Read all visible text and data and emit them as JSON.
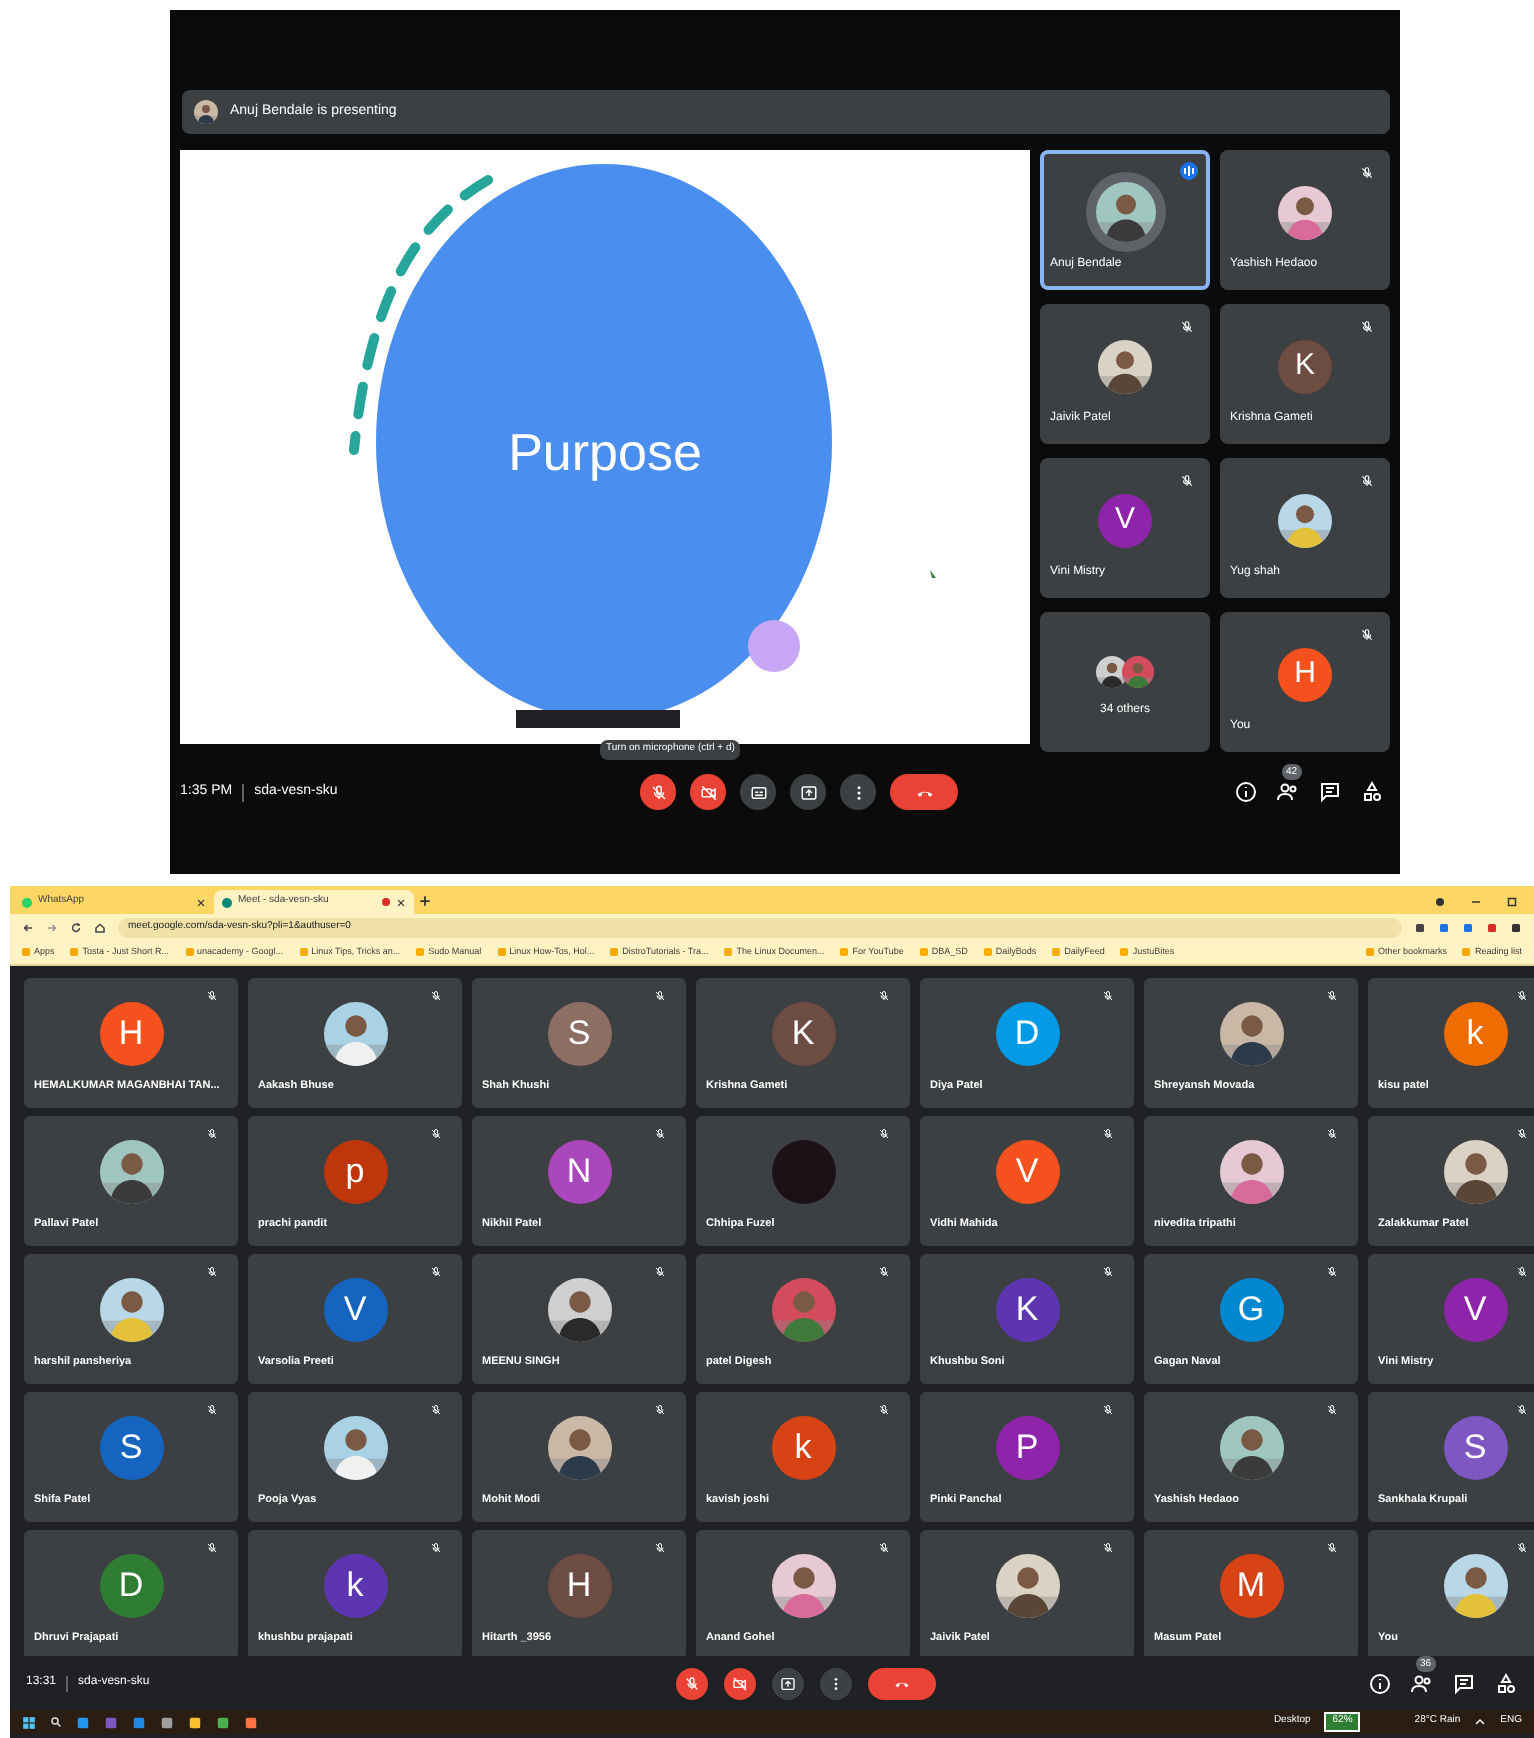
{
  "top_meeting": {
    "presenter_banner": "Anuj Bendale is presenting",
    "slide": {
      "title": "Purpose"
    },
    "tiles": [
      {
        "kind": "person",
        "name": "Anuj Bendale",
        "muted": false,
        "speaking": true,
        "selected": true
      },
      {
        "kind": "person",
        "name": "Yashish Hedaoo",
        "muted": true,
        "speaking": false,
        "selected": false
      },
      {
        "kind": "person",
        "name": "Jaivik Patel",
        "muted": true,
        "speaking": false,
        "selected": false
      },
      {
        "kind": "person",
        "name": "Krishna Gameti",
        "avatar": {
          "kind": "letter",
          "letter": "K",
          "color": "#6d4c41"
        },
        "muted": true,
        "speaking": false,
        "selected": false
      },
      {
        "kind": "person",
        "name": "Vini Mistry",
        "avatar": {
          "kind": "letter",
          "letter": "V",
          "color": "#8e24aa"
        },
        "muted": true,
        "speaking": false,
        "selected": false
      },
      {
        "kind": "person",
        "name": "Yug shah",
        "muted": true,
        "speaking": false,
        "selected": false
      },
      {
        "kind": "others",
        "name": "34 others",
        "muted": false,
        "speaking": false,
        "selected": false
      },
      {
        "kind": "person",
        "name": "You",
        "avatar": {
          "kind": "letter",
          "letter": "H",
          "color": "#f4511e"
        },
        "muted": true,
        "speaking": false,
        "selected": false
      }
    ],
    "time": "1:35 PM",
    "meeting_code": "sda-vesn-sku",
    "tooltip": "Turn on microphone (ctrl + d)",
    "controls": [
      {
        "kind": "mic",
        "on": false
      },
      {
        "kind": "camera",
        "on": false
      },
      {
        "kind": "captions"
      },
      {
        "kind": "present"
      },
      {
        "kind": "more"
      },
      {
        "kind": "leave"
      }
    ],
    "participant_count": "42"
  },
  "browser": {
    "tabs": [
      {
        "title": "WhatsApp",
        "selected": false,
        "recording": false
      },
      {
        "title": "Meet - sda-vesn-sku",
        "selected": true,
        "recording": true
      }
    ],
    "url": "meet.google.com/sda-vesn-sku?pli=1&authuser=0",
    "bookmarks": [
      "Apps",
      "Tosta - Just Short R...",
      "unacademy - Googl...",
      "Linux Tips, Tricks an...",
      "Sudo Manual",
      "Linux How-Tos, Hol...",
      "DistroTutorials - Tra...",
      "The Linux Documen...",
      "For YouTube",
      "DBA_SD",
      "DailyBods",
      "DailyFeed",
      "JustuBites",
      "Other bookmarks",
      "Reading list"
    ]
  },
  "grid": {
    "tiles": [
      {
        "name": "HEMALKUMAR MAGANBHAI TAN...",
        "avatar": {
          "kind": "letter",
          "letter": "H",
          "color": "#f4511e"
        }
      },
      {
        "name": "Aakash Bhuse"
      },
      {
        "name": "Shah Khushi",
        "avatar": {
          "kind": "letter",
          "letter": "S",
          "color": "#8d6e63"
        }
      },
      {
        "name": "Krishna Gameti",
        "avatar": {
          "kind": "letter",
          "letter": "K",
          "color": "#6d4c41"
        }
      },
      {
        "name": "Diya Patel",
        "avatar": {
          "kind": "letter",
          "letter": "D",
          "color": "#039be5"
        }
      },
      {
        "name": "Shreyansh Movada"
      },
      {
        "name": "kisu patel",
        "avatar": {
          "kind": "letter",
          "letter": "k",
          "color": "#ef6c00"
        }
      },
      {
        "name": "Pallavi Patel"
      },
      {
        "name": "prachi pandit",
        "avatar": {
          "kind": "letter",
          "letter": "p",
          "color": "#bf360c"
        }
      },
      {
        "name": "Nikhil Patel",
        "avatar": {
          "kind": "letter",
          "letter": "N",
          "color": "#ab47bc"
        }
      },
      {
        "name": "Chhipa Fuzel",
        "avatar": {
          "kind": "blank",
          "color": "#1a1016"
        }
      },
      {
        "name": "Vidhi Mahida",
        "avatar": {
          "kind": "letter",
          "letter": "V",
          "color": "#f4511e"
        }
      },
      {
        "name": "nivedita tripathi"
      },
      {
        "name": "Zalakkumar Patel"
      },
      {
        "name": "harshil pansheriya"
      },
      {
        "name": "Varsolia Preeti",
        "avatar": {
          "kind": "letter",
          "letter": "V",
          "color": "#1565c0"
        }
      },
      {
        "name": "MEENU SINGH"
      },
      {
        "name": "patel Digesh"
      },
      {
        "name": "Khushbu Soni",
        "avatar": {
          "kind": "letter",
          "letter": "K",
          "color": "#5e35b1"
        }
      },
      {
        "name": "Gagan Naval",
        "avatar": {
          "kind": "letter",
          "letter": "G",
          "color": "#0288d1"
        }
      },
      {
        "name": "Vini Mistry",
        "avatar": {
          "kind": "letter",
          "letter": "V",
          "color": "#8e24aa"
        }
      },
      {
        "name": "Shifa Patel",
        "avatar": {
          "kind": "letter",
          "letter": "S",
          "color": "#1565c0"
        }
      },
      {
        "name": "Pooja Vyas"
      },
      {
        "name": "Mohit Modi"
      },
      {
        "name": "kavish joshi",
        "avatar": {
          "kind": "letter",
          "letter": "k",
          "color": "#d84315"
        }
      },
      {
        "name": "Pinki Panchal",
        "avatar": {
          "kind": "letter",
          "letter": "P",
          "color": "#8e24aa"
        }
      },
      {
        "name": "Yashish Hedaoo"
      },
      {
        "name": "Sankhala Krupali",
        "avatar": {
          "kind": "letter",
          "letter": "S",
          "color": "#7e57c2"
        }
      },
      {
        "name": "Dhruvi Prajapati",
        "avatar": {
          "kind": "letter",
          "letter": "D",
          "color": "#2e7d32"
        }
      },
      {
        "name": "khushbu prajapati",
        "avatar": {
          "kind": "letter",
          "letter": "k",
          "color": "#5e35b1"
        }
      },
      {
        "name": "Hitarth _3956",
        "avatar": {
          "kind": "letter",
          "letter": "H",
          "color": "#6d4c41"
        }
      },
      {
        "name": "Anand Gohel"
      },
      {
        "name": "Jaivik Patel"
      },
      {
        "name": "Masum Patel",
        "avatar": {
          "kind": "letter",
          "letter": "M",
          "color": "#d84315"
        }
      },
      {
        "name": "You"
      }
    ]
  },
  "bottom_bar": {
    "time": "13:31",
    "meeting_code": "sda-vesn-sku",
    "controls": [
      {
        "kind": "mic",
        "on": false
      },
      {
        "kind": "camera",
        "on": false
      },
      {
        "kind": "present"
      },
      {
        "kind": "more"
      },
      {
        "kind": "leave"
      }
    ],
    "participant_count": "36"
  },
  "taskbar": {
    "desktop_label": "Desktop",
    "battery": "62%",
    "weather": "28°C Rain",
    "language": "ENG"
  }
}
